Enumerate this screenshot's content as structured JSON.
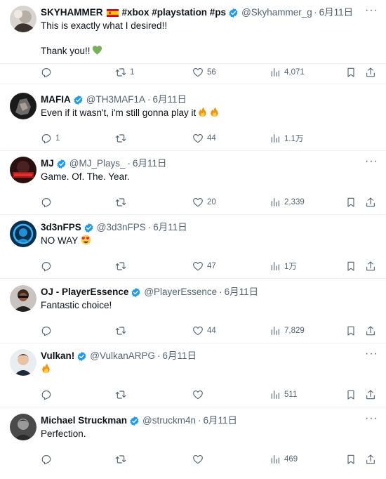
{
  "tweets": [
    {
      "name": "SKYHAMMER",
      "hashtags": "#xbox #playstation #ps",
      "handle": "@Skyhammer_g",
      "date": "6月11日",
      "lines": [
        "This is exactly what I desired!!",
        "Thank you!!"
      ],
      "replies": "",
      "retweets": "1",
      "likes": "56",
      "views": "4,071"
    },
    {
      "name": "MAFIA",
      "handle": "@TH3MAF1A",
      "date": "6月11日",
      "lines": [
        "Even if it wasn't, i'm still gonna play it"
      ],
      "replies": "1",
      "retweets": "",
      "likes": "44",
      "views": "1.1万"
    },
    {
      "name": "MJ",
      "handle": "@MJ_Plays_",
      "date": "6月11日",
      "lines": [
        "Game. Of. The. Year."
      ],
      "replies": "",
      "retweets": "",
      "likes": "20",
      "views": "2,339"
    },
    {
      "name": "3d3nFPS",
      "handle": "@3d3nFPS",
      "date": "6月11日",
      "lines": [
        "NO WAY"
      ],
      "replies": "",
      "retweets": "",
      "likes": "47",
      "views": "1万"
    },
    {
      "name": "OJ - PlayerEssence",
      "handle": "@PlayerEssence",
      "date": "6月11日",
      "lines": [
        "Fantastic choice!"
      ],
      "replies": "",
      "retweets": "",
      "likes": "44",
      "views": "7,829"
    },
    {
      "name": "Vulkan!",
      "handle": "@VulkanARPG",
      "date": "6月11日",
      "lines": [
        ""
      ],
      "replies": "",
      "retweets": "",
      "likes": "",
      "views": "511"
    },
    {
      "name": "Michael Struckman",
      "handle": "@struckm4n",
      "date": "6月11日",
      "lines": [
        "Perfection."
      ],
      "replies": "",
      "retweets": "",
      "likes": "",
      "views": "469"
    }
  ],
  "icons": {
    "reply": "reply-icon",
    "retweet": "retweet-icon",
    "like": "heart-icon",
    "views": "views-icon",
    "bookmark": "bookmark-icon",
    "share": "share-icon",
    "more": "more-icon",
    "verified": "verified-badge-icon"
  },
  "colors": {
    "verified": "#1d9bf0",
    "text": "#0f1419",
    "secondary": "#536471",
    "divider": "#eff3f4"
  }
}
